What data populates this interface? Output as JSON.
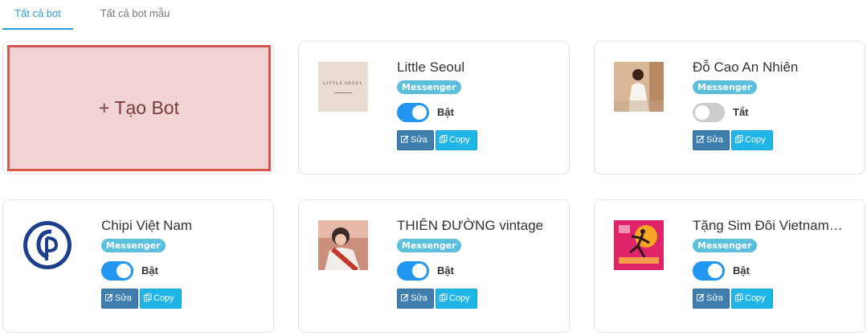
{
  "tabs": [
    {
      "label": "Tất cả bot",
      "active": true
    },
    {
      "label": "Tất cả bot mẫu",
      "active": false
    }
  ],
  "create_label": "+ Tạo Bot",
  "bots": [
    {
      "name": "Little Seoul",
      "channel": "Messenger",
      "enabled": true,
      "state": "Bật",
      "edit": "Sửa",
      "copy": "Copy",
      "avatar": "little-seoul-logo",
      "avatar_text": "LITTLE SEOUL"
    },
    {
      "name": "Đỗ Cao An Nhiên",
      "channel": "Messenger",
      "enabled": false,
      "state": "Tắt",
      "edit": "Sửa",
      "copy": "Copy",
      "avatar": "woman-white-dress-photo"
    },
    {
      "name": "Chipi Việt Nam",
      "channel": "Messenger",
      "enabled": true,
      "state": "Bật",
      "edit": "Sửa",
      "copy": "Copy",
      "avatar": "chipi-logo"
    },
    {
      "name": "THIÊN ĐƯỜNG vintage",
      "channel": "Messenger",
      "enabled": true,
      "state": "Bật",
      "edit": "Sửa",
      "copy": "Copy",
      "avatar": "woman-sash-photo"
    },
    {
      "name": "Tặng Sim Đôi Vietnam…",
      "channel": "Messenger",
      "enabled": true,
      "state": "Bật",
      "edit": "Sửa",
      "copy": "Copy",
      "avatar": "dancing-figure-poster"
    }
  ],
  "colors": {
    "accent": "#2a9fd6",
    "toggle_on": "#2196f3",
    "badge": "#5bc0de",
    "edit_btn": "#3e7fb0",
    "copy_btn": "#1fb5e8",
    "create_border": "#d9534f",
    "create_bg": "#f0d3d2"
  }
}
